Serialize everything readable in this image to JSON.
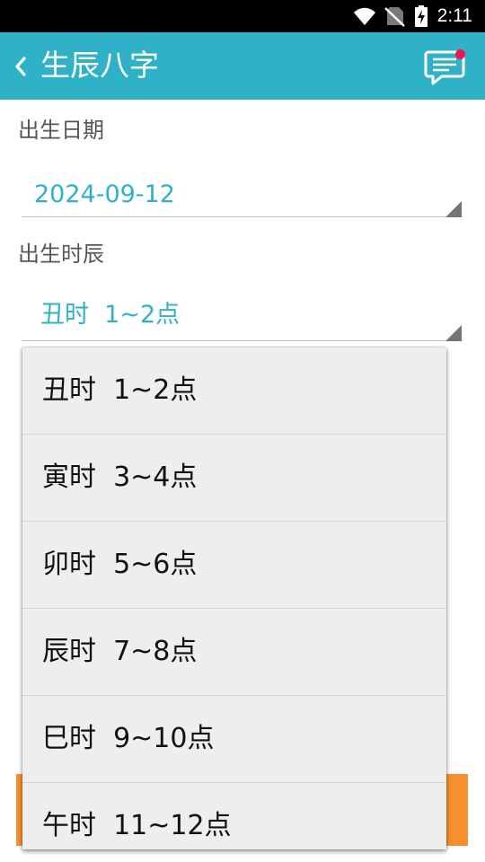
{
  "status_bar": {
    "time": "2:11",
    "icons": [
      "wifi-icon",
      "no-sim-icon",
      "battery-charging-icon"
    ]
  },
  "app_bar": {
    "back_icon": "chevron-left-icon",
    "title": "生辰八字",
    "message_icon": "message-icon",
    "has_notification": true,
    "notification_color": "#ef1651"
  },
  "form": {
    "birth_date_label": "出生日期",
    "birth_date_value": "2024-09-12",
    "birth_hour_label": "出生时辰",
    "birth_hour_value": "丑时  1~2点"
  },
  "dropdown": {
    "options": [
      {
        "label": "丑时  1~2点"
      },
      {
        "label": "寅时  3~4点"
      },
      {
        "label": "卯时  5~6点"
      },
      {
        "label": "辰时  7~8点"
      },
      {
        "label": "巳时  9~10点"
      },
      {
        "label": "午时  11~12点"
      }
    ]
  },
  "colors": {
    "accent": "#2fb1c8",
    "button": "#f6902f",
    "dropdown_bg": "#eeeeee"
  }
}
